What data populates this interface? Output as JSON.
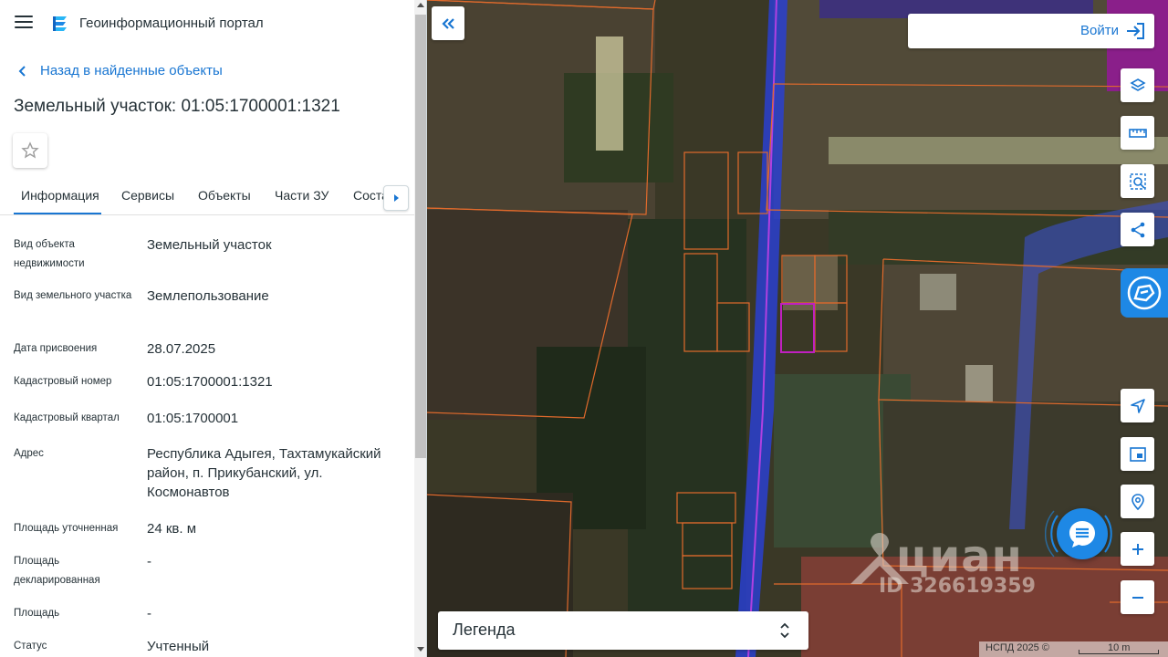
{
  "app": {
    "title": "Геоинформационный портал",
    "menu_icon": "hamburger-icon",
    "logo_icon": "portal-logo-icon"
  },
  "nav": {
    "back_label": "Назад в найденные объекты"
  },
  "object": {
    "title": "Земельный участок: 01:05:1700001:1321"
  },
  "tabs": [
    {
      "label": "Информация",
      "active": true
    },
    {
      "label": "Сервисы",
      "active": false
    },
    {
      "label": "Объекты",
      "active": false
    },
    {
      "label": "Части ЗУ",
      "active": false
    },
    {
      "label": "Соста",
      "active": false
    }
  ],
  "fields": [
    {
      "label": "Вид объекта недвижимости",
      "value": "Земельный участок"
    },
    {
      "label": "Вид земельного участка",
      "value": "Землепользование"
    },
    {
      "label": "Дата присвоения",
      "value": "28.07.2025"
    },
    {
      "label": "Кадастровый номер",
      "value": "01:05:1700001:1321"
    },
    {
      "label": "Кадастровый квартал",
      "value": "01:05:1700001"
    },
    {
      "label": "Адрес",
      "value": "Республика Адыгея, Тахтамукайский район, п. Прикубанский, ул. Космонавтов"
    },
    {
      "label": "Площадь уточненная",
      "value": "24 кв. м"
    },
    {
      "label": "Площадь декларированная",
      "value": "-"
    },
    {
      "label": "Площадь",
      "value": "-"
    },
    {
      "label": "Статус",
      "value": "Учтенный"
    }
  ],
  "map": {
    "login_label": "Войти",
    "legend_label": "Легенда",
    "copyright": "НСПД 2025 ©",
    "scale_label": "10 m",
    "watermark_brand": "циан",
    "watermark_id": "ID 326619359",
    "tools": [
      {
        "name": "layers-icon"
      },
      {
        "name": "ruler-icon"
      },
      {
        "name": "area-select-icon"
      },
      {
        "name": "share-icon"
      },
      {
        "name": "navigation-arrow-icon"
      },
      {
        "name": "picture-in-picture-icon"
      },
      {
        "name": "location-search-icon"
      },
      {
        "name": "zoom-in-icon"
      },
      {
        "name": "zoom-out-icon"
      }
    ]
  },
  "colors": {
    "accent": "#1976d2",
    "parcel_outline": "#e06a2c",
    "selected_parcel": "#c020c0",
    "road_overlay": "#2a3fd0"
  }
}
